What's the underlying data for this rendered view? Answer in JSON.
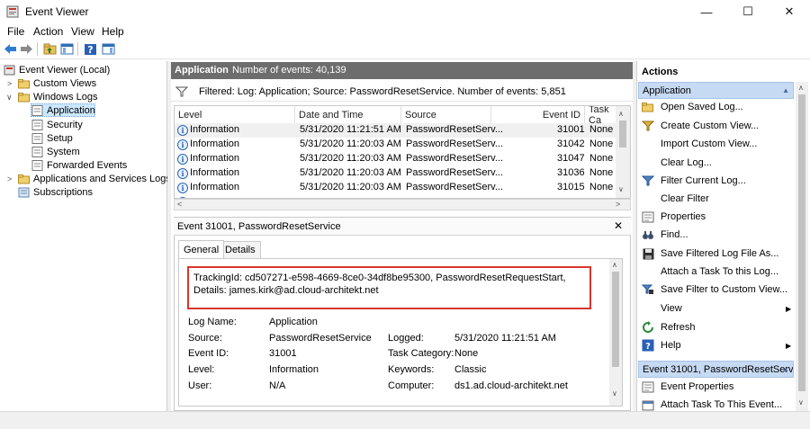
{
  "window": {
    "title": "Event Viewer",
    "minimize": "—",
    "maximize": "☐",
    "close": "✕"
  },
  "menu": [
    "File",
    "Action",
    "View",
    "Help"
  ],
  "tree": {
    "root": "Event Viewer (Local)",
    "custom_views": "Custom Views",
    "windows_logs": "Windows Logs",
    "logs": [
      "Application",
      "Security",
      "Setup",
      "System",
      "Forwarded Events"
    ],
    "apps_services": "Applications and Services Logs",
    "subscriptions": "Subscriptions"
  },
  "center": {
    "log_name": "Application",
    "event_count_text": "Number of events: 40,139",
    "filter_text": "Filtered: Log: Application; Source: PasswordResetService. Number of events: 5,851",
    "columns": [
      "Level",
      "Date and Time",
      "Source",
      "Event ID",
      "Task Ca"
    ],
    "rows": [
      {
        "level": "Information",
        "datetime": "5/31/2020 11:21:51 AM",
        "source": "PasswordResetServ...",
        "event_id": "31001",
        "task": "None"
      },
      {
        "level": "Information",
        "datetime": "5/31/2020 11:20:03 AM",
        "source": "PasswordResetServ...",
        "event_id": "31042",
        "task": "None"
      },
      {
        "level": "Information",
        "datetime": "5/31/2020 11:20:03 AM",
        "source": "PasswordResetServ...",
        "event_id": "31047",
        "task": "None"
      },
      {
        "level": "Information",
        "datetime": "5/31/2020 11:20:03 AM",
        "source": "PasswordResetServ...",
        "event_id": "31036",
        "task": "None"
      },
      {
        "level": "Information",
        "datetime": "5/31/2020 11:20:03 AM",
        "source": "PasswordResetServ...",
        "event_id": "31015",
        "task": "None"
      }
    ]
  },
  "detail": {
    "title": "Event 31001, PasswordResetService",
    "tabs": [
      "General",
      "Details"
    ],
    "message": "TrackingId: cd507271-e598-4669-8ce0-34df8be95300, PasswordResetRequestStart, Details: james.kirk@ad.cloud-architekt.net",
    "props": {
      "log_name_label": "Log Name:",
      "log_name": "Application",
      "source_label": "Source:",
      "source": "PasswordResetService",
      "logged_label": "Logged:",
      "logged": "5/31/2020 11:21:51 AM",
      "event_id_label": "Event ID:",
      "event_id": "31001",
      "task_cat_label": "Task Category:",
      "task_cat": "None",
      "level_label": "Level:",
      "level": "Information",
      "keywords_label": "Keywords:",
      "keywords": "Classic",
      "user_label": "User:",
      "user": "N/A",
      "computer_label": "Computer:",
      "computer": "ds1.ad.cloud-architekt.net"
    }
  },
  "actions": {
    "header": "Actions",
    "section1": "Application",
    "items1": [
      {
        "label": "Open Saved Log...",
        "icon": "folder-open-icon"
      },
      {
        "label": "Create Custom View...",
        "icon": "filter-icon"
      },
      {
        "label": "Import Custom View...",
        "icon": "blank"
      },
      {
        "label": "Clear Log...",
        "icon": "blank"
      },
      {
        "label": "Filter Current Log...",
        "icon": "filter-icon"
      },
      {
        "label": "Clear Filter",
        "icon": "blank"
      },
      {
        "label": "Properties",
        "icon": "properties-icon"
      },
      {
        "label": "Find...",
        "icon": "binoculars-icon"
      },
      {
        "label": "Save Filtered Log File As...",
        "icon": "save-icon"
      },
      {
        "label": "Attach a Task To this Log...",
        "icon": "blank"
      },
      {
        "label": "Save Filter to Custom View...",
        "icon": "filter-save-icon"
      },
      {
        "label": "View",
        "icon": "blank",
        "submenu": true
      },
      {
        "label": "Refresh",
        "icon": "refresh-icon"
      },
      {
        "label": "Help",
        "icon": "help-icon",
        "submenu": true
      }
    ],
    "section2": "Event 31001, PasswordResetServ...",
    "items2": [
      {
        "label": "Event Properties",
        "icon": "properties-icon"
      },
      {
        "label": "Attach Task To This Event...",
        "icon": "task-icon"
      }
    ]
  }
}
